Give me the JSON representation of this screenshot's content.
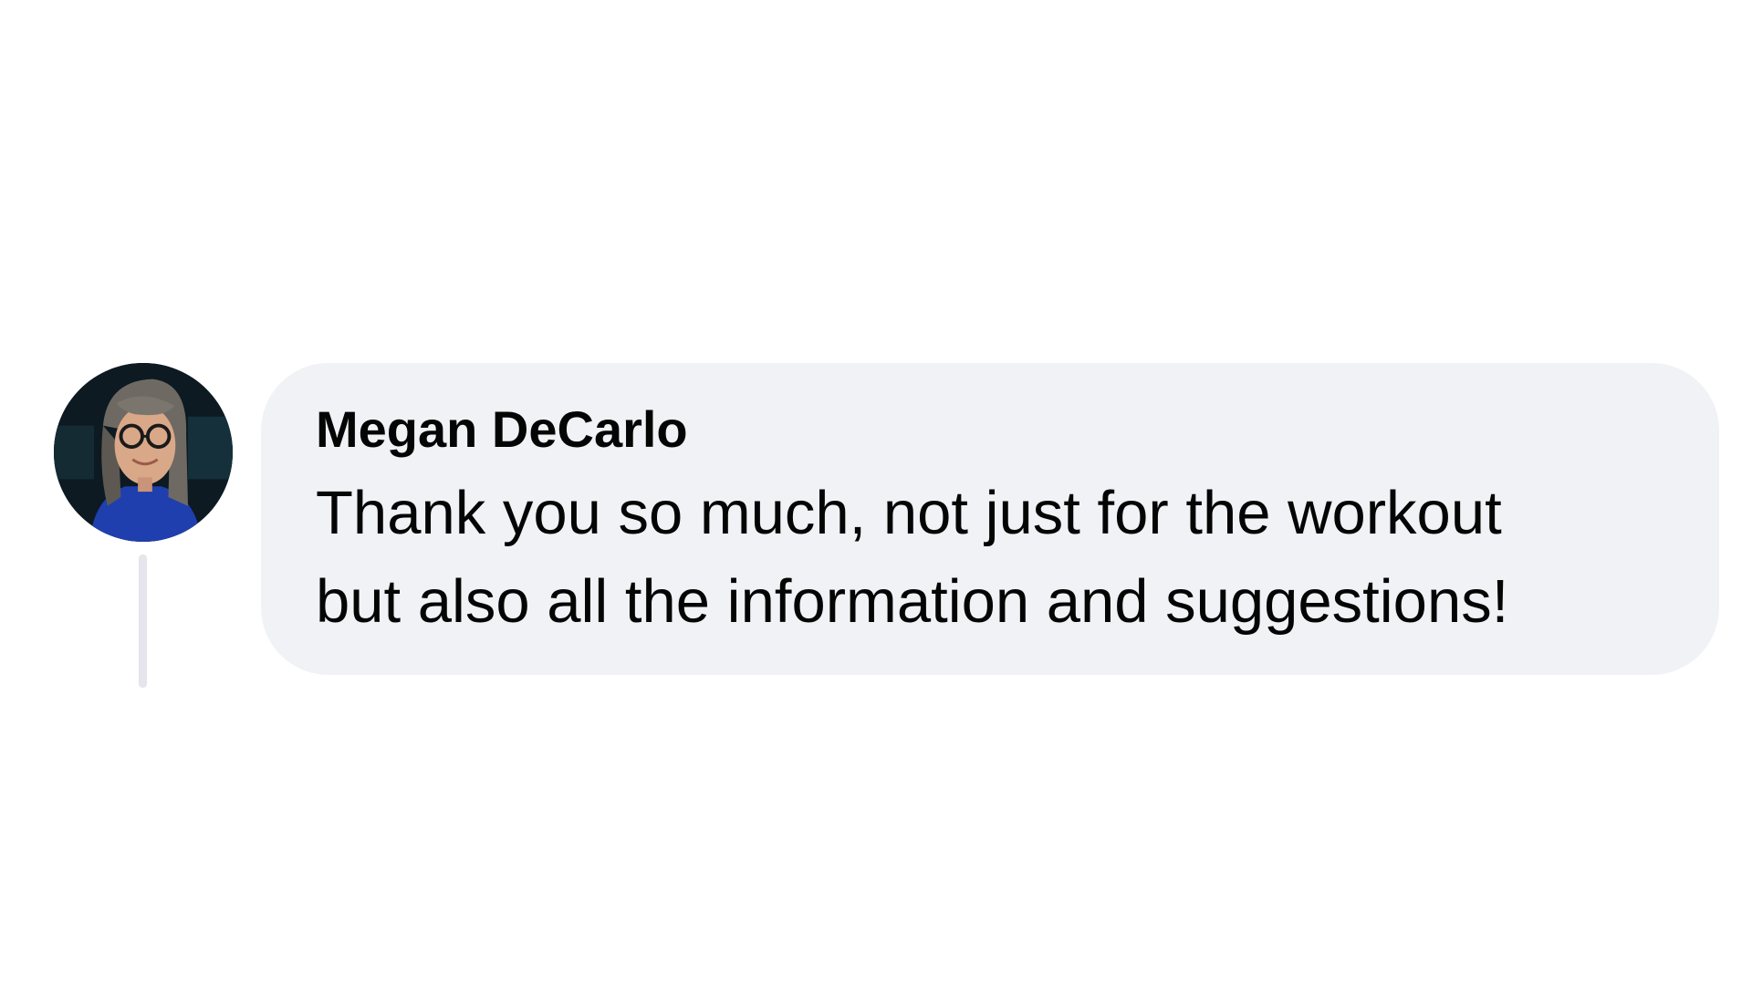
{
  "comment": {
    "author": "Megan DeCarlo",
    "text_lines": [
      "Thank you so much, not just for the workout",
      "but also all the information and suggestions!"
    ]
  },
  "colors": {
    "bubble_background": "#f0f2f5",
    "text": "#050505",
    "thread_line": "#e4e6eb",
    "avatar_shirt": "#1f3fae"
  },
  "icons": {
    "avatar": "profile-photo"
  }
}
